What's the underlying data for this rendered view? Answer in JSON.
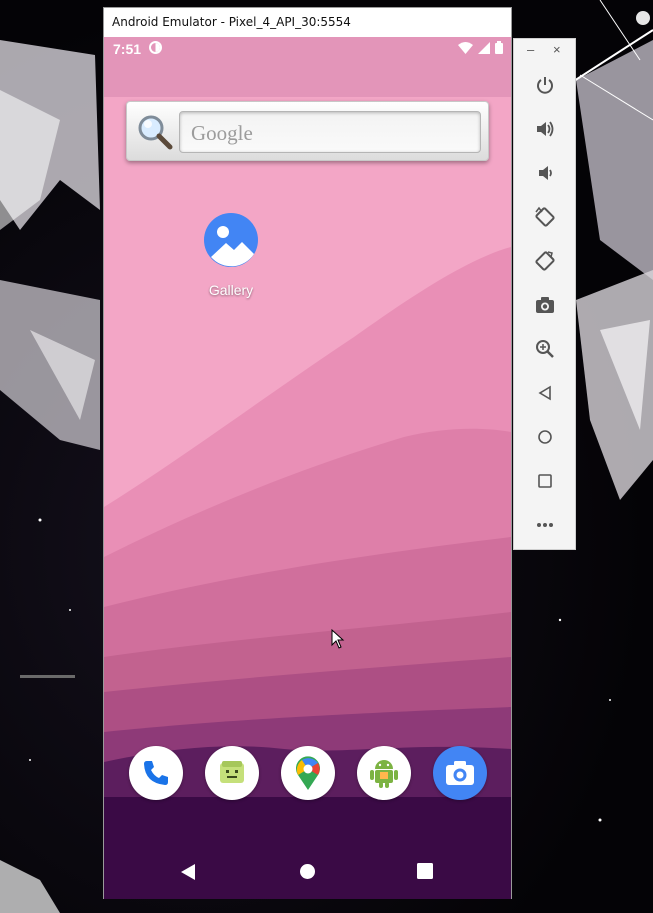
{
  "window": {
    "title": "Android Emulator - Pixel_4_API_30:5554"
  },
  "status_bar": {
    "time": "7:51",
    "icons": [
      "data-saver-icon",
      "wifi-icon",
      "signal-icon",
      "battery-icon"
    ]
  },
  "search_widget": {
    "placeholder": "Google",
    "icon": "magnifier-icon"
  },
  "home_apps": [
    {
      "label": "Gallery",
      "icon": "gallery-icon"
    }
  ],
  "dock": [
    "phone-icon",
    "messages-icon",
    "maps-icon",
    "android-app-icon",
    "camera-icon"
  ],
  "nav_bar": [
    "back-icon",
    "home-icon",
    "recents-icon"
  ],
  "toolbar": {
    "window_controls": {
      "minimize": "–",
      "close": "×"
    },
    "buttons": [
      "power",
      "volume-up",
      "volume-down",
      "rotate-left",
      "rotate-right",
      "screenshot",
      "zoom",
      "back",
      "home",
      "overview",
      "more"
    ]
  },
  "colors": {
    "wallpaper_top": "#f3a6c6",
    "wallpaper_bottom": "#3a0a45",
    "camera_blue": "#4285f4"
  }
}
